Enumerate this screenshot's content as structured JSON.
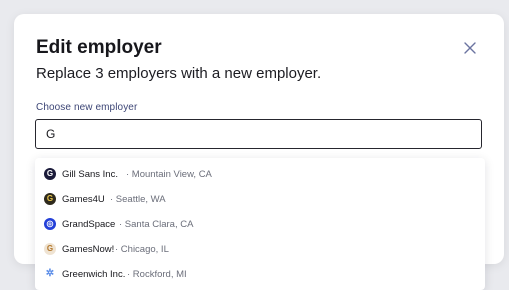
{
  "modal": {
    "title": "Edit employer",
    "subtitle": "Replace 3 employers with a new employer.",
    "field_label": "Choose new employer",
    "input_value": "G"
  },
  "options": [
    {
      "name": "Gill Sans Inc.",
      "location": "· Mountain View, CA",
      "icon": "gill-sans-logo-icon",
      "icon_bg": "#1b1b3a",
      "icon_fg": "#ffffff",
      "icon_glyph": "G"
    },
    {
      "name": "Games4U",
      "location": "· Seattle, WA",
      "icon": "games4u-logo-icon",
      "icon_bg": "#2e2a1c",
      "icon_fg": "#e8c44a",
      "icon_glyph": "G"
    },
    {
      "name": "GrandSpace",
      "location": "· Santa Clara, CA",
      "icon": "grandspace-logo-icon",
      "icon_bg": "#2440d8",
      "icon_fg": "#ffffff",
      "icon_glyph": "◎"
    },
    {
      "name": "GamesNow!",
      "location": "· Chicago, IL",
      "icon": "gamesnow-logo-icon",
      "icon_bg": "#efe3d2",
      "icon_fg": "#b3772b",
      "icon_glyph": "G"
    },
    {
      "name": "Greenwich Inc.",
      "location": "· Rockford, MI",
      "icon": "greenwich-logo-icon",
      "icon_bg": "#ffffff",
      "icon_fg": "#5b8de8",
      "icon_glyph": "✲"
    }
  ],
  "colors": {
    "close_icon": "#6b74a0",
    "label": "#3d4676"
  }
}
